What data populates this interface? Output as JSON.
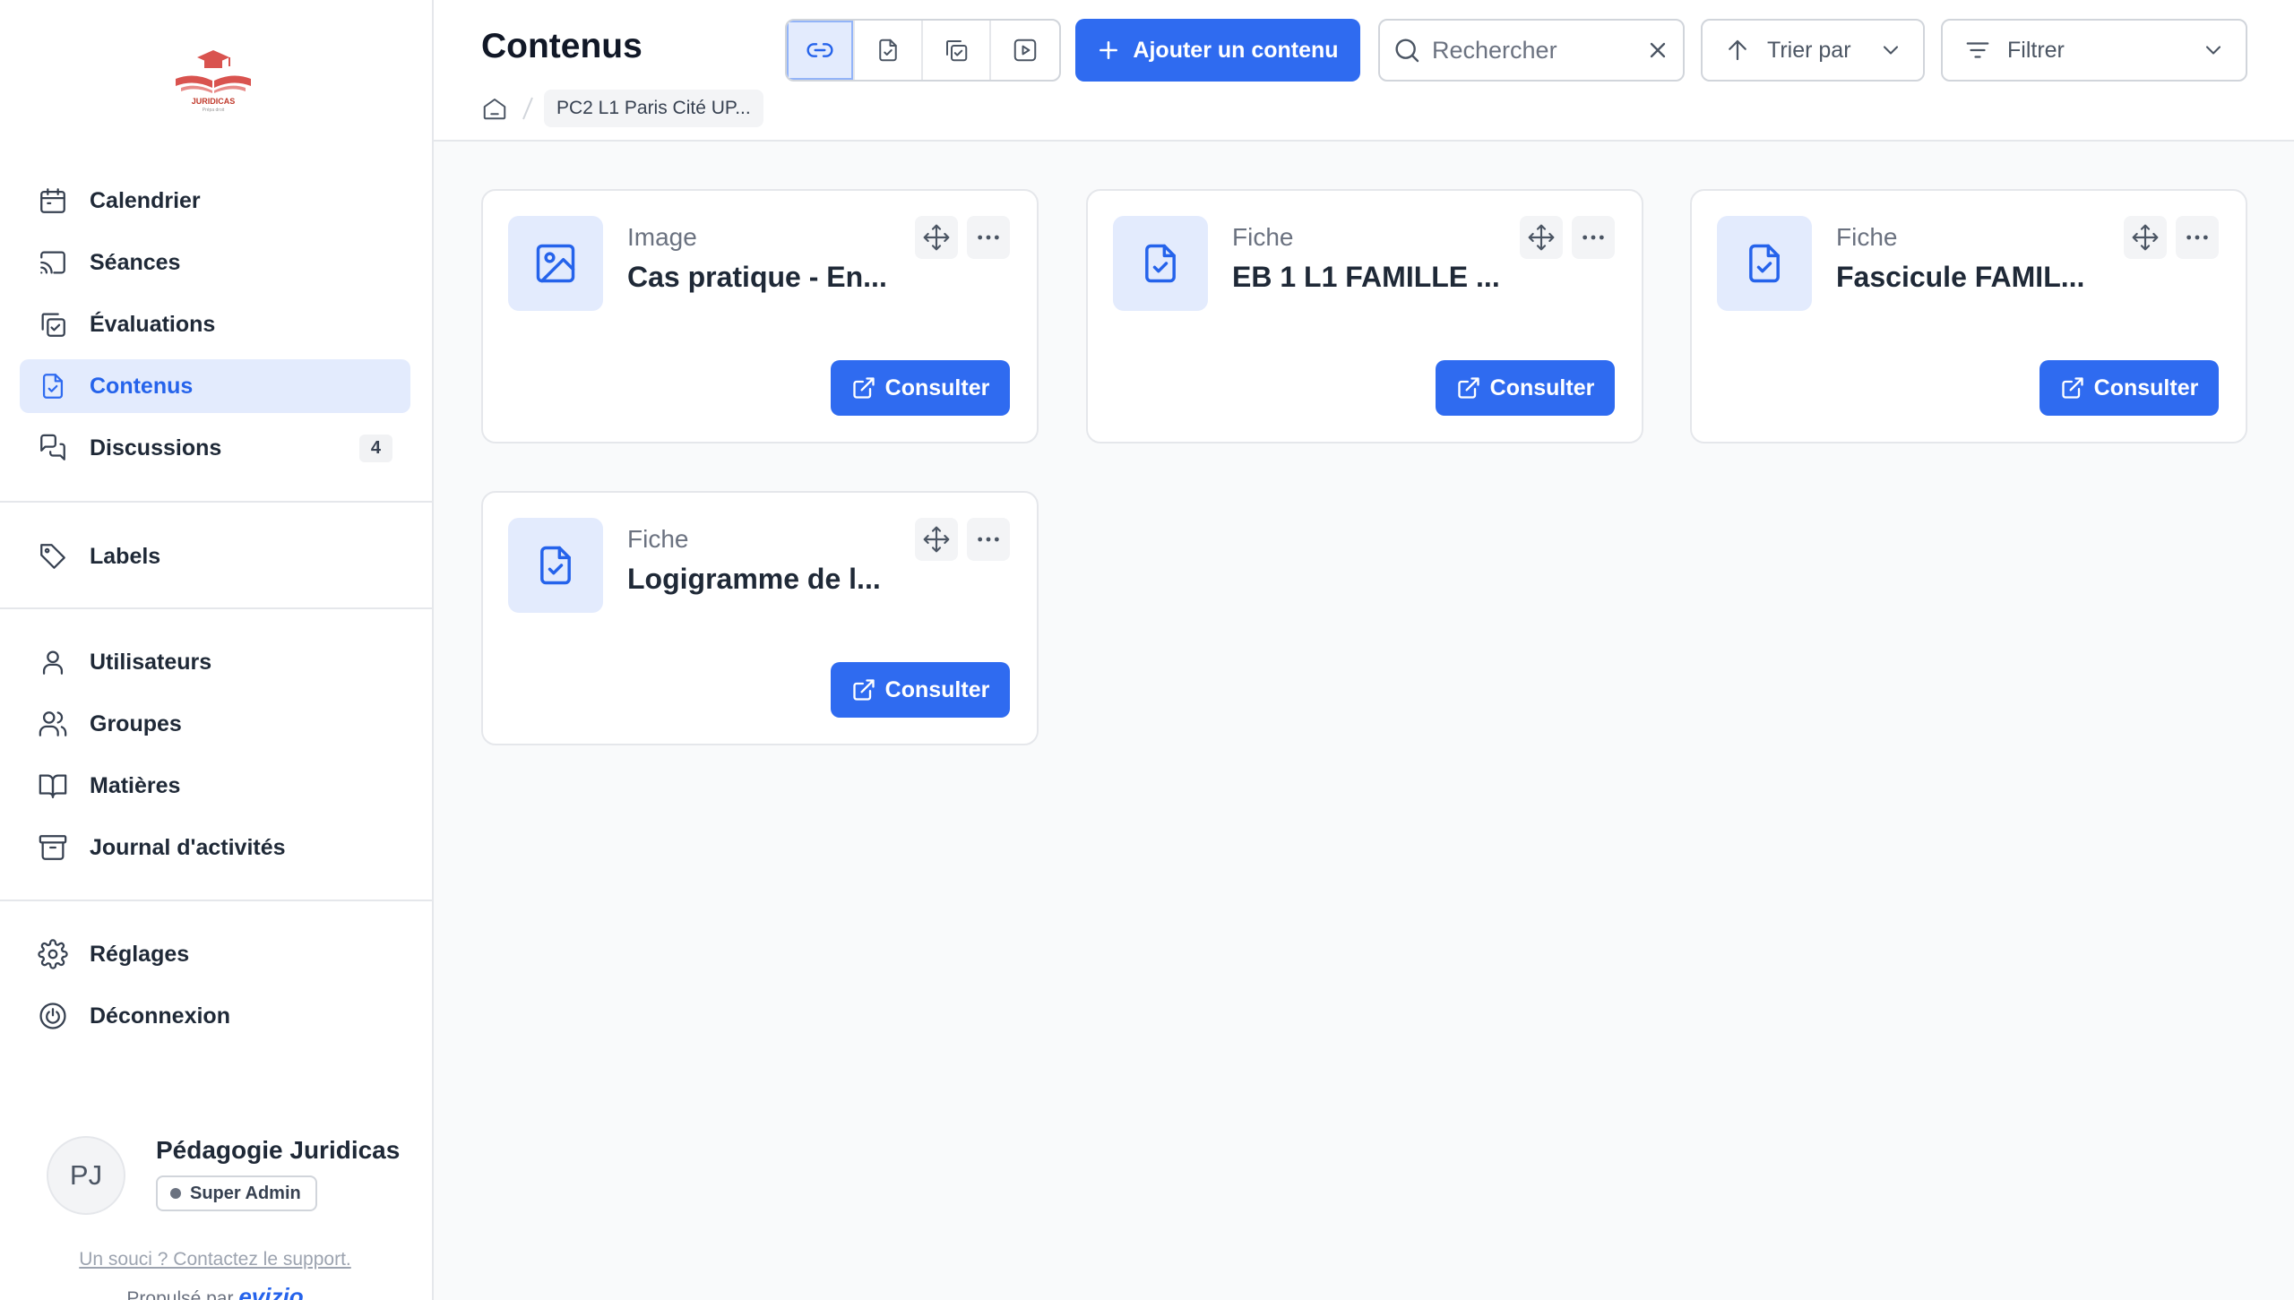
{
  "sidebar": {
    "logo_text": "JURIDICAS",
    "logo_tagline": "Prépa droit",
    "nav_main": [
      {
        "label": "Calendrier",
        "icon": "calendar-icon"
      },
      {
        "label": "Séances",
        "icon": "cast-icon"
      },
      {
        "label": "Évaluations",
        "icon": "copy-check-icon"
      },
      {
        "label": "Contenus",
        "icon": "file-check-icon",
        "active": true
      },
      {
        "label": "Discussions",
        "icon": "chat-icon",
        "badge": "4"
      }
    ],
    "nav_labels": [
      {
        "label": "Labels",
        "icon": "tag-icon"
      }
    ],
    "nav_admin": [
      {
        "label": "Utilisateurs",
        "icon": "user-icon"
      },
      {
        "label": "Groupes",
        "icon": "users-icon"
      },
      {
        "label": "Matières",
        "icon": "book-icon"
      },
      {
        "label": "Journal d'activités",
        "icon": "archive-icon"
      }
    ],
    "nav_settings": [
      {
        "label": "Réglages",
        "icon": "gear-icon"
      },
      {
        "label": "Déconnexion",
        "icon": "power-icon"
      }
    ],
    "profile": {
      "initials": "PJ",
      "name": "Pédagogie Juridicas",
      "role": "Super Admin"
    },
    "support_link": "Un souci ? Contactez le support.",
    "powered_by": "Propulsé par",
    "powered_brand": "evizio"
  },
  "header": {
    "title": "Contenus",
    "add_button": "Ajouter un contenu",
    "search_placeholder": "Rechercher",
    "sort_label": "Trier par",
    "filter_label": "Filtrer",
    "breadcrumb": "PC2 L1 Paris Cité UP..."
  },
  "cards": [
    {
      "type": "Image",
      "title": "Cas pratique - En...",
      "icon": "image-icon",
      "action": "Consulter"
    },
    {
      "type": "Fiche",
      "title": "EB 1 L1 FAMILLE ...",
      "icon": "file-check-icon",
      "action": "Consulter"
    },
    {
      "type": "Fiche",
      "title": "Fascicule FAMIL...",
      "icon": "file-check-icon",
      "action": "Consulter"
    },
    {
      "type": "Fiche",
      "title": "Logigramme de l...",
      "icon": "file-check-icon",
      "action": "Consulter"
    }
  ],
  "colors": {
    "accent": "#2f6bf0",
    "active_bg": "#e3ebfd",
    "logo_red": "#d9534f"
  }
}
